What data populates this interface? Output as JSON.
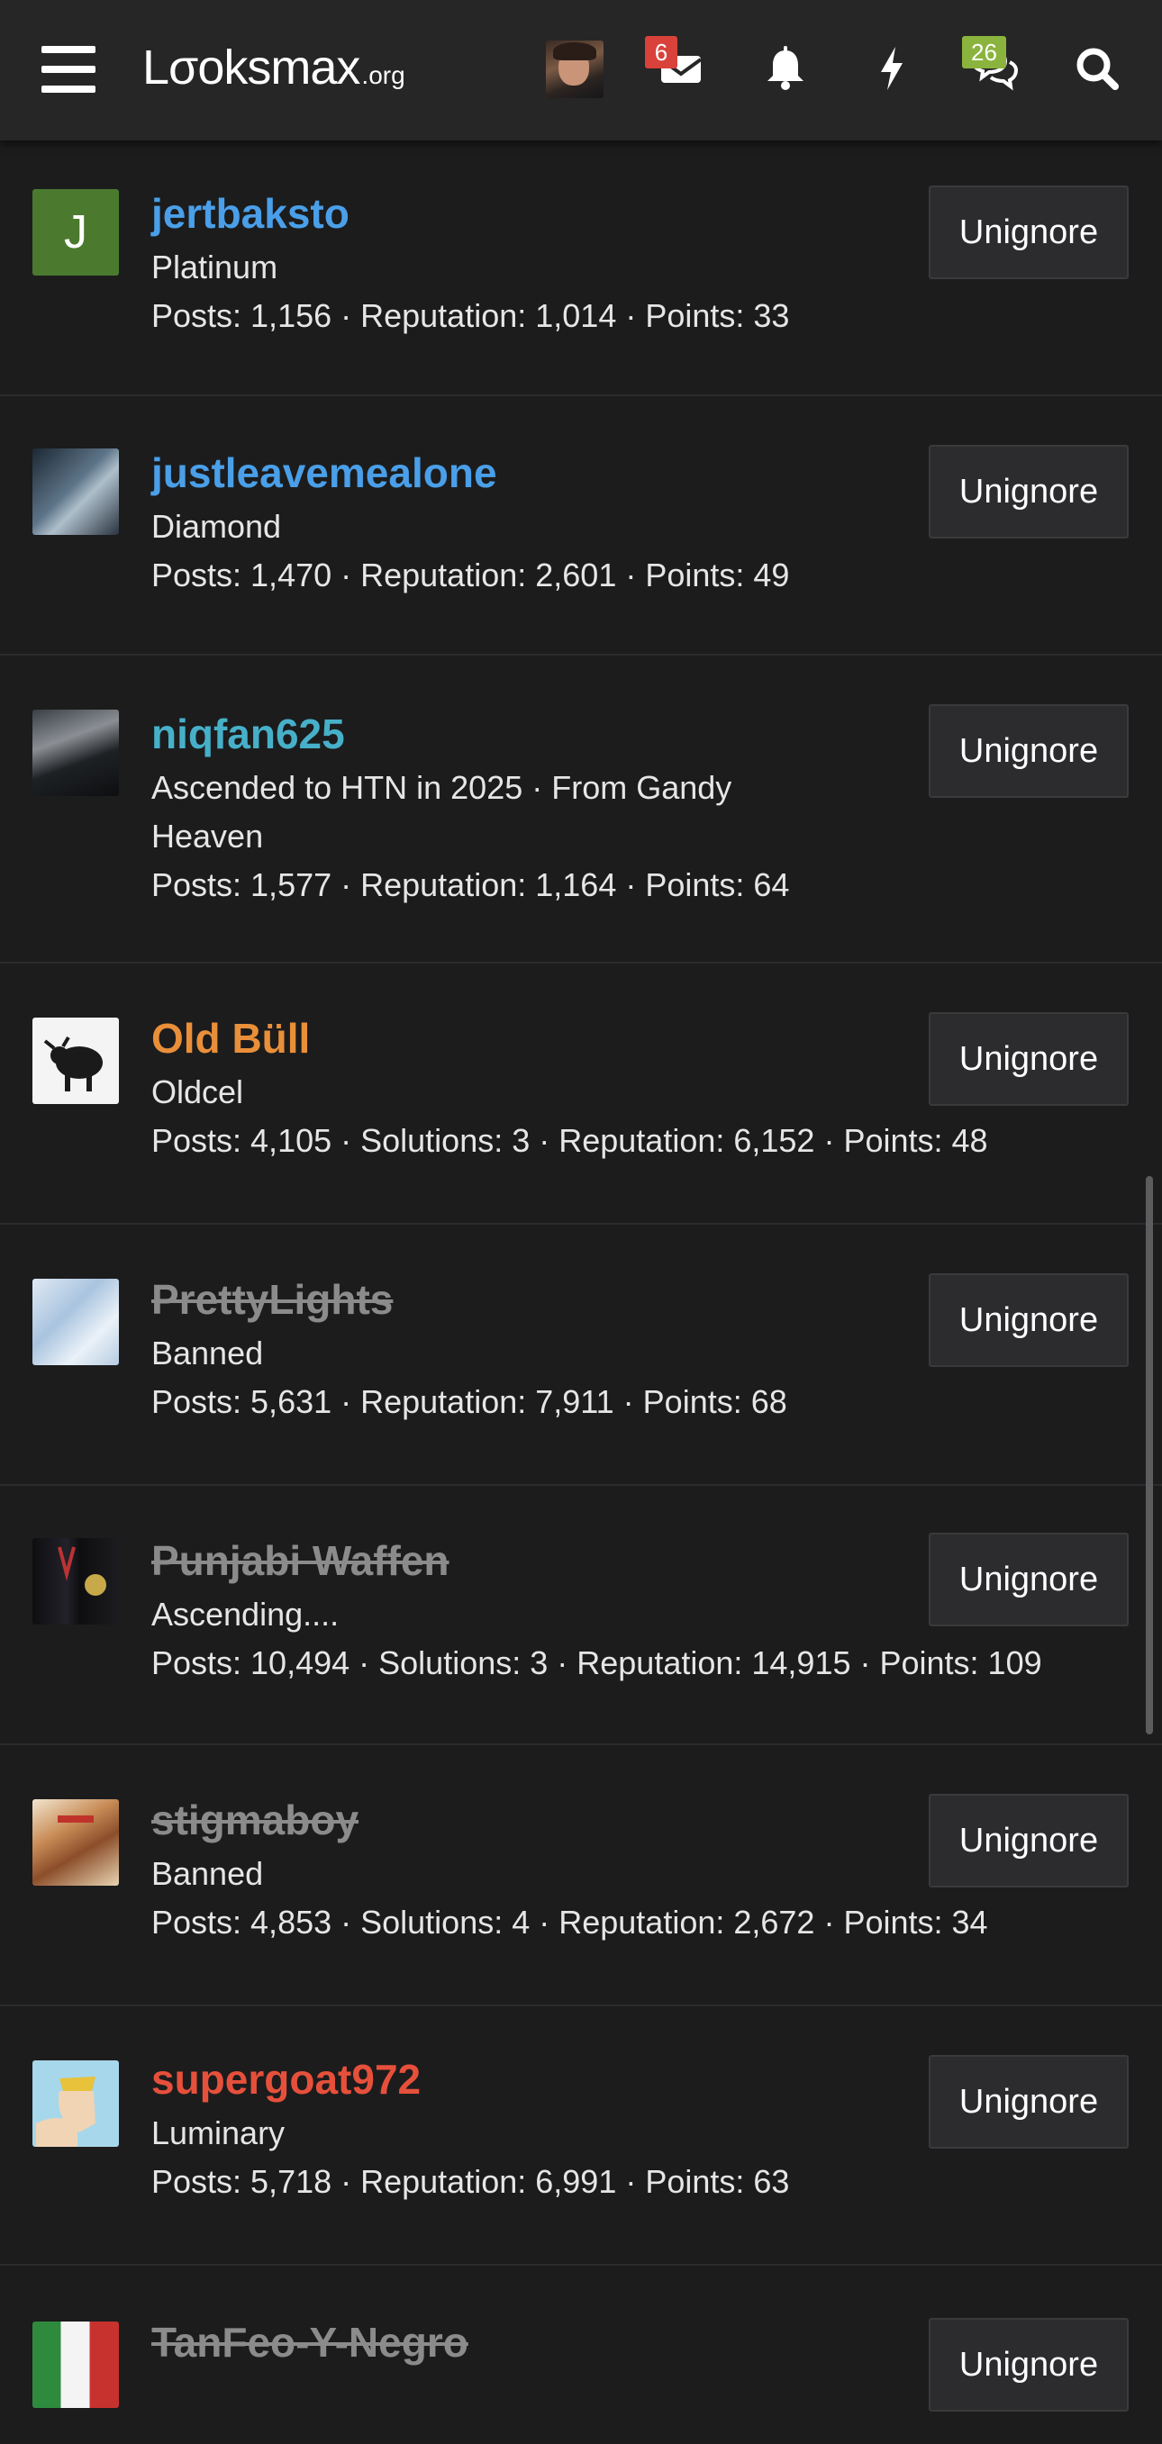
{
  "header": {
    "logo_main": "Lσoksmax",
    "logo_tld": ".org",
    "icons": [
      "menu-icon",
      "envelope-icon",
      "bell-icon",
      "lightning-icon",
      "chat-icon",
      "search-icon"
    ],
    "inbox_badge": "6",
    "conversations_badge": "26"
  },
  "action_label": "Unignore",
  "users": [
    {
      "name": "jertbaksto",
      "name_color": "#4a9fe8",
      "banned": false,
      "avatar_letter": "J",
      "title": "Platinum",
      "stats": "Posts: 1,156 · Reputation: 1,014 · Points: 33"
    },
    {
      "name": "justleavemealone",
      "name_color": "#4a9fe8",
      "banned": false,
      "avatar_letter": "",
      "title": "Diamond",
      "stats": "Posts: 1,470 · Reputation: 2,601 · Points: 49"
    },
    {
      "name": "niqfan625",
      "name_color": "#47b0c9",
      "banned": false,
      "avatar_letter": "",
      "title": "Ascended to HTN in 2025 · From Gandy Heaven",
      "stats": "Posts: 1,577 · Reputation: 1,164 · Points: 64"
    },
    {
      "name": "Old Büll",
      "name_color": "#e98f3a",
      "banned": false,
      "avatar_letter": "",
      "title": "Oldcel",
      "stats": "Posts: 4,105 · Solutions: 3 · Reputation: 6,152 · Points: 48"
    },
    {
      "name": "PrettyLights",
      "name_color": "#8b8b8b",
      "banned": true,
      "avatar_letter": "",
      "title": "Banned",
      "stats": "Posts: 5,631 · Reputation: 7,911 · Points: 68"
    },
    {
      "name": "Punjabi Waffen",
      "name_color": "#8b8b8b",
      "banned": true,
      "avatar_letter": "",
      "title": "Ascending....",
      "stats": "Posts: 10,494 · Solutions: 3 · Reputation: 14,915 · Points: 109"
    },
    {
      "name": "stigmaboy",
      "name_color": "#8b8b8b",
      "banned": true,
      "avatar_letter": "",
      "title": "Banned",
      "stats": "Posts: 4,853 · Solutions: 4 · Reputation: 2,672 · Points: 34"
    },
    {
      "name": "supergoat972",
      "name_color": "#e6503b",
      "banned": false,
      "avatar_letter": "",
      "title": "Luminary",
      "stats": "Posts: 5,718 · Reputation: 6,991 · Points: 63"
    },
    {
      "name": "TanFeo-Y-Negro",
      "name_color": "#8b8b8b",
      "banned": true,
      "avatar_letter": "",
      "title": "",
      "stats": ""
    }
  ]
}
